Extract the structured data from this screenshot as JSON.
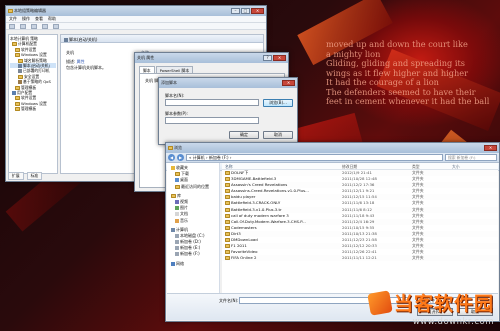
{
  "colors": {
    "accent": "#c21b12",
    "watermark": "#ff7a1a",
    "window_frame": "#6f7f93"
  },
  "wallpaper": {
    "poem": [
      "moved up and down the court like",
      "a mighty lion",
      "Gliding, gliding and spreading its",
      "wings as it flew higher and higher",
      "It had the courage of a lion",
      "The defenders seemed to have their",
      "feet in cement whenever it had the ball"
    ]
  },
  "watermark": {
    "title": "当客软件园",
    "url": "www.downkr.com"
  },
  "policy_window": {
    "title": "本地组策略编辑器",
    "menu": [
      "文件",
      "操作",
      "查看",
      "帮助"
    ],
    "tree": [
      "本地计算机 策略",
      "计算机配置",
      "软件设置",
      "Windows 设置",
      "域名解析策略",
      "脚本(启动/关机)",
      "已部署的打印机",
      "安全设置",
      "基于策略的 QoS",
      "管理模板",
      "用户配置",
      "软件设置",
      "Windows 设置",
      "管理模板"
    ],
    "header": "脚本(启动/关机)",
    "sub_title": "关机",
    "sub_link": "属性",
    "sub_desc_label": "描述:",
    "sub_desc": "包含计算机关机脚本。",
    "col_name": "名称",
    "items": [
      "启动",
      "关机"
    ],
    "status_tabs": [
      "扩展",
      "标准"
    ]
  },
  "props_window": {
    "title": "关机 属性",
    "tabs": [
      "脚本",
      "PowerShell 脚本"
    ],
    "panel_header": "关机 脚本(本地计算机)"
  },
  "add_dialog": {
    "title": "添加脚本",
    "name_label": "脚本名(N):",
    "params_label": "脚本参数(P):",
    "browse_label": "浏览(B)...",
    "ok_label": "确定",
    "cancel_label": "取消"
  },
  "browse_window": {
    "title": "浏览",
    "address": "« 计算机 › 新加卷 (F:) ›",
    "search_placeholder": "搜索 新加卷 (F:)",
    "cmd": [
      "组织 ▾",
      "新建文件夹"
    ],
    "nav": {
      "favorites": [
        "收藏夹",
        "下载",
        "桌面",
        "最近访问的位置"
      ],
      "libraries": [
        "库",
        "视频",
        "图片",
        "文档",
        "音乐"
      ],
      "computer": [
        "计算机",
        "本地磁盘 (C:)",
        "新加卷 (D:)",
        "新加卷 (E:)",
        "新加卷 (F:)"
      ],
      "network": [
        "网络"
      ]
    },
    "columns": [
      "名称",
      "修改日期",
      "类型",
      "大小"
    ],
    "files": [
      {
        "name": "DOLNF下",
        "date": "2012/1/9 21:41",
        "type": "文件夹"
      },
      {
        "name": "3DMGAME-Battlefield.3",
        "date": "2011/10/28 12:48",
        "type": "文件夹"
      },
      {
        "name": "Assassin's Creed Revelations",
        "date": "2011/12/2 17:36",
        "type": "文件夹"
      },
      {
        "name": "Assassins.Creed.Revelations.v1.0.Plus...",
        "date": "2011/12/11 9:21",
        "type": "文件夹"
      },
      {
        "name": "baidu player",
        "date": "2011/12/15 11:54",
        "type": "文件夹"
      },
      {
        "name": "Battlefield.3.CRACK.ONLY",
        "date": "2011/11/6 13:18",
        "type": "文件夹"
      },
      {
        "name": "Battlefield.3.v1.0.Plus.3.tr",
        "date": "2011/11/6 8:12",
        "type": "文件夹"
      },
      {
        "name": "call of duty modern warfare 3",
        "date": "2011/11/18 9:43",
        "type": "文件夹"
      },
      {
        "name": "Call.Of.Duty.Modern.Warfare.3.CHS.P...",
        "date": "2011/12/4 16:29",
        "type": "文件夹"
      },
      {
        "name": "Codemasters",
        "date": "2011/10/15 9:55",
        "type": "文件夹"
      },
      {
        "name": "Dirt3",
        "date": "2011/10/13 21:38",
        "type": "文件夹"
      },
      {
        "name": "DMDownLoad",
        "date": "2011/12/23 21:58",
        "type": "文件夹"
      },
      {
        "name": "F1 2011",
        "date": "2011/12/12 20:33",
        "type": "文件夹"
      },
      {
        "name": "FavoriteVideo",
        "date": "2011/12/26 22:41",
        "type": "文件夹"
      },
      {
        "name": "FIFA Online 2",
        "date": "2011/11/11 12:21",
        "type": "文件夹"
      }
    ],
    "filename_label": "文件名(N):",
    "filetype": "所有文件",
    "open_label": "打开(O)",
    "cancel_label": "取消"
  }
}
